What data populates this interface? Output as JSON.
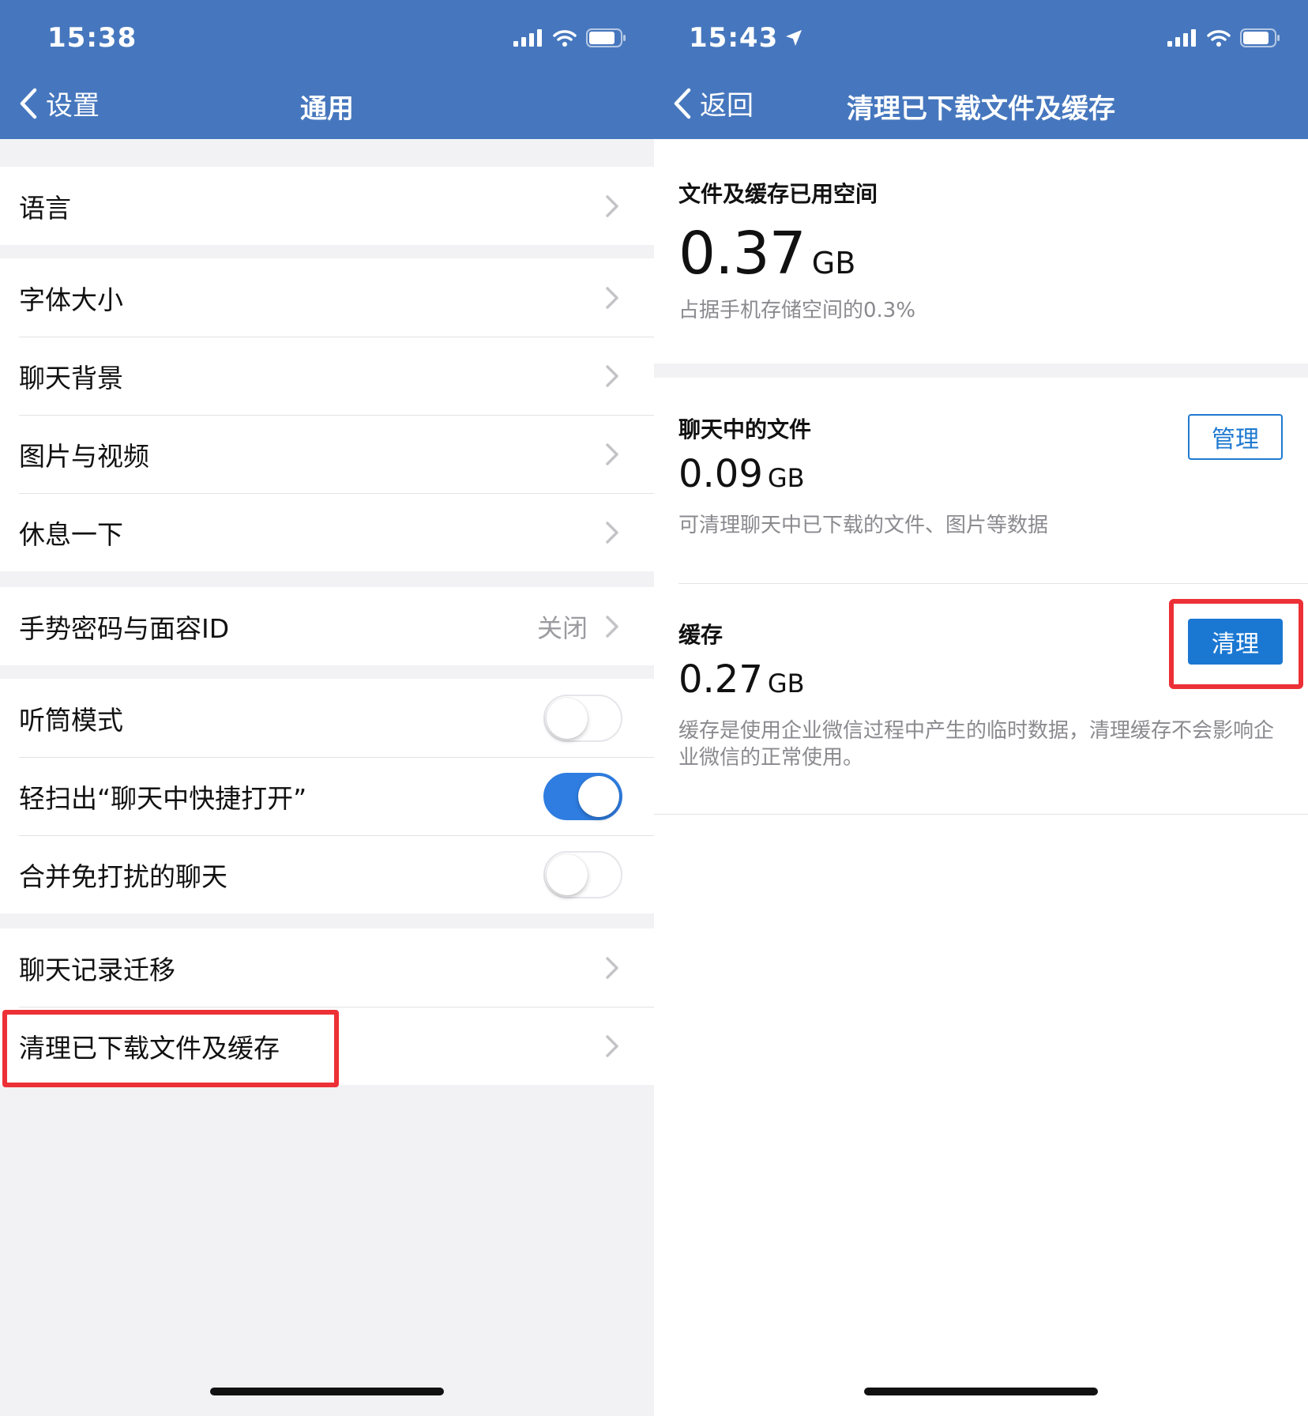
{
  "left": {
    "status": {
      "time": "15:38"
    },
    "nav": {
      "back_label": "设置",
      "title": "通用"
    },
    "groups": [
      {
        "items": [
          {
            "label": "语言",
            "type": "chevron"
          }
        ]
      },
      {
        "items": [
          {
            "label": "字体大小",
            "type": "chevron"
          },
          {
            "label": "聊天背景",
            "type": "chevron"
          },
          {
            "label": "图片与视频",
            "type": "chevron"
          },
          {
            "label": "休息一下",
            "type": "chevron"
          }
        ]
      },
      {
        "items": [
          {
            "label": "手势密码与面容ID",
            "value": "关闭",
            "type": "chevron"
          }
        ]
      },
      {
        "items": [
          {
            "label": "听筒模式",
            "type": "toggle",
            "on": false
          },
          {
            "label": "轻扫出“聊天中快捷打开”",
            "type": "toggle",
            "on": true
          },
          {
            "label": "合并免打扰的聊天",
            "type": "toggle",
            "on": false
          }
        ]
      },
      {
        "items": [
          {
            "label": "聊天记录迁移",
            "type": "chevron"
          },
          {
            "label": "清理已下载文件及缓存",
            "type": "chevron",
            "highlighted": true
          }
        ]
      }
    ]
  },
  "right": {
    "status": {
      "time": "15:43"
    },
    "nav": {
      "back_label": "返回",
      "title": "清理已下载文件及缓存"
    },
    "total": {
      "label": "文件及缓存已用空间",
      "value": "0.37",
      "unit": "GB",
      "desc": "占据手机存储空间的0.3%"
    },
    "chat_files": {
      "label": "聊天中的文件",
      "value": "0.09",
      "unit": "GB",
      "desc": "可清理聊天中已下载的文件、图片等数据",
      "button": "管理"
    },
    "cache": {
      "label": "缓存",
      "value": "0.27",
      "unit": "GB",
      "desc": "缓存是使用企业微信过程中产生的临时数据，清理缓存不会影响企业微信的正常使用。",
      "button": "清理"
    }
  },
  "colors": {
    "nav_bar": "#4677be",
    "toggle_on": "#2f7de1",
    "primary_button": "#1b78d2",
    "highlight": "#ec3036"
  }
}
